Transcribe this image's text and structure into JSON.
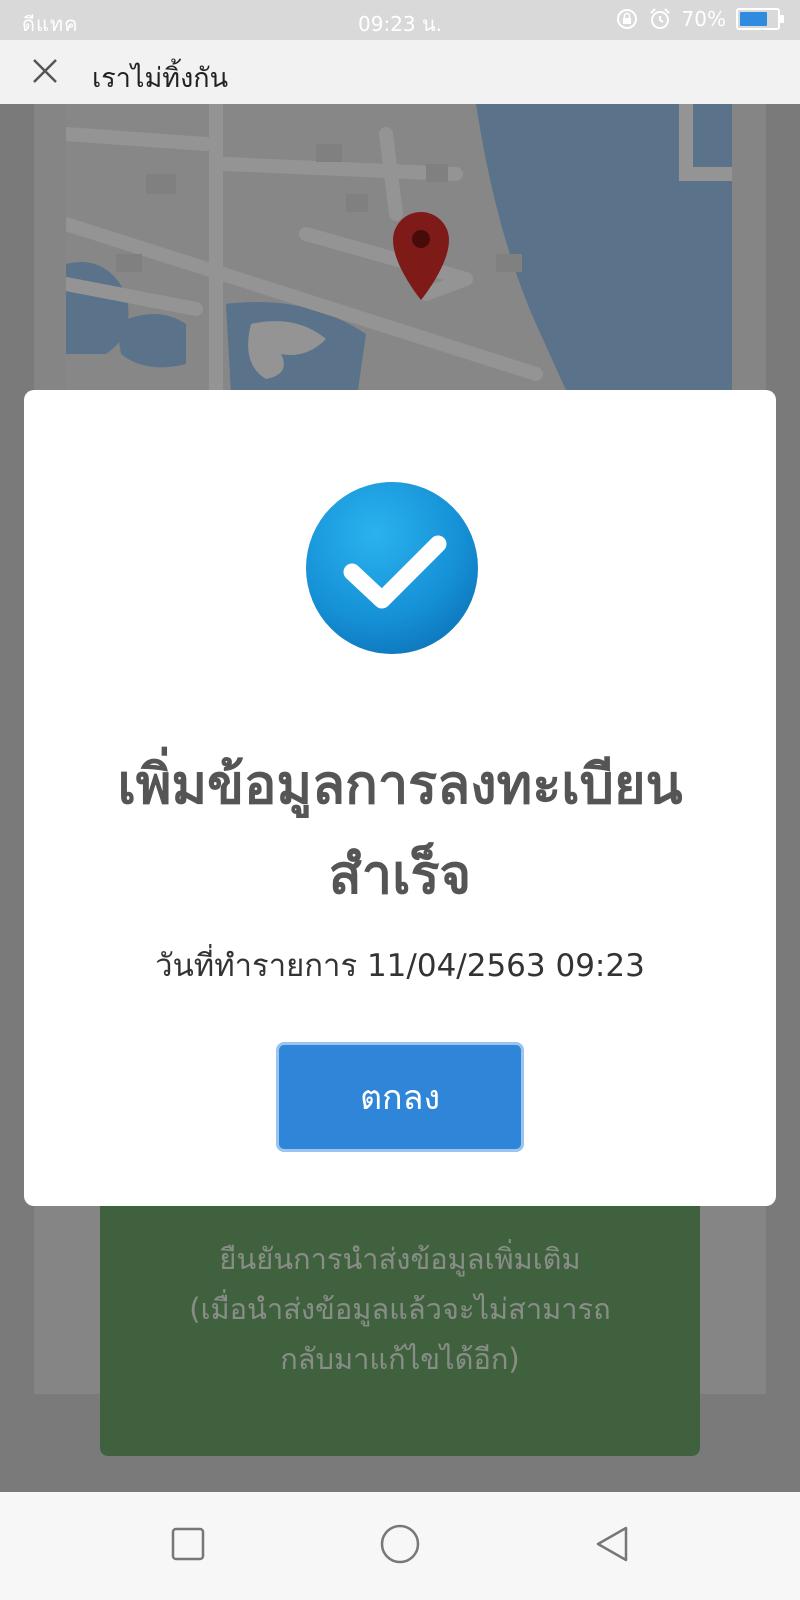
{
  "status_bar": {
    "carrier": "ดีแทค",
    "time": "09:23 น.",
    "battery": "70%",
    "battery_level": 0.7
  },
  "header": {
    "title": "เราไม่ทิ้งกัน"
  },
  "background": {
    "submit_text_line1": "ยืนยันการนำส่งข้อมูลเพิ่มเติม",
    "submit_text_line2": "(เมื่อนำส่งข้อมูลแล้วจะไม่สามารถ",
    "submit_text_line3": "กลับมาแก้ไขได้อีก)"
  },
  "modal": {
    "title_line1": "เพิ่มข้อมูลการลงทะเบียน",
    "title_line2": "สำเร็จ",
    "date_text": "วันที่ทำรายการ 11/04/2563 09:23",
    "ok_label": "ตกลง"
  },
  "colors": {
    "accent": "#2f86d9",
    "check_blue": "#1590d6",
    "confirm_green": "#6fa86b"
  }
}
